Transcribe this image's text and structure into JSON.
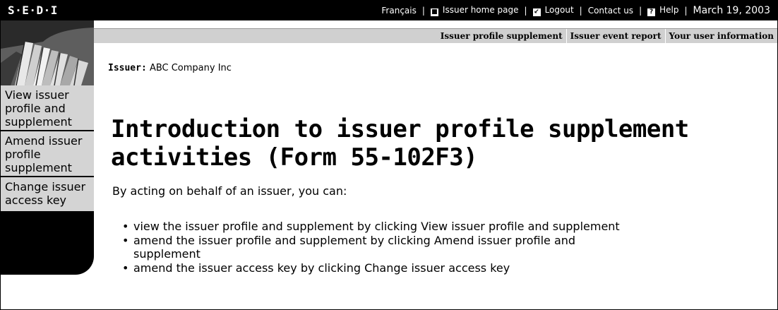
{
  "topbar": {
    "logo": "S·E·D·I",
    "links": {
      "francais": "Français",
      "issuer_home": "Issuer home page",
      "logout": "Logout",
      "contact": "Contact us",
      "help": "Help"
    },
    "date": "March 19, 2003"
  },
  "tabs": {
    "profile_supplement": "Issuer profile supplement",
    "event_report": "Issuer event report",
    "user_info": "Your user information"
  },
  "sidebar": {
    "items": [
      {
        "label": "View issuer profile and supplement"
      },
      {
        "label": "Amend issuer profile supplement"
      },
      {
        "label": "Change issuer access key"
      }
    ]
  },
  "issuer": {
    "label": "Issuer:",
    "name": "ABC Company Inc"
  },
  "main": {
    "heading": "Introduction to issuer profile supplement activities (Form 55-102F3)",
    "intro": "By acting on behalf of an issuer, you can:",
    "bullets": [
      "view the issuer profile and supplement by clicking View issuer profile and supplement",
      "amend the issuer profile and supplement by clicking Amend issuer profile and supplement",
      "amend the issuer access key by clicking Change issuer access key"
    ]
  },
  "colors": {
    "bar": "#000000",
    "tab_bg": "#d0d0d0",
    "nav_bg": "#d4d4d4"
  }
}
